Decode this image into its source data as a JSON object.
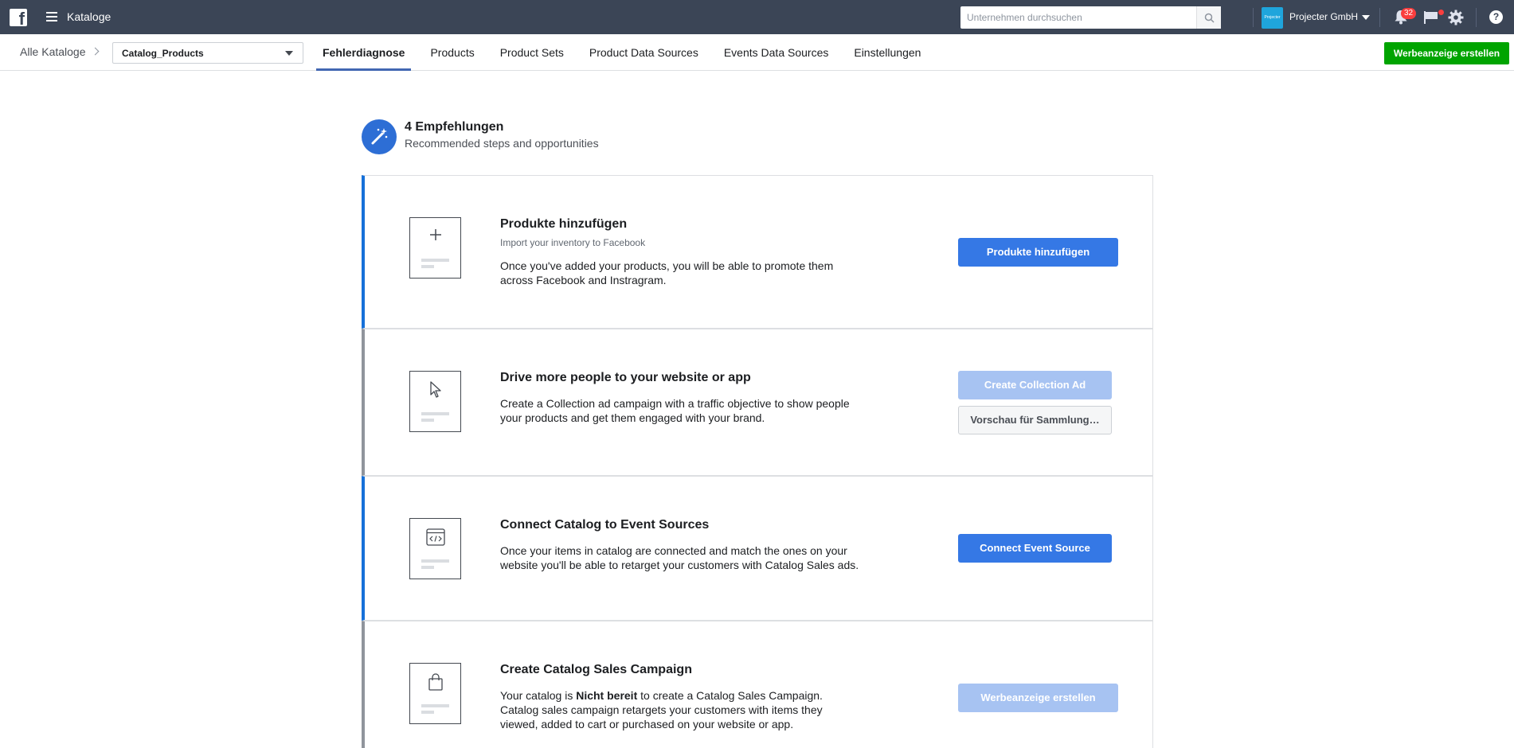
{
  "topbar": {
    "app_title": "Kataloge",
    "search_placeholder": "Unternehmen durchsuchen",
    "business_name": "Projecter GmbH",
    "business_avatar_text": "Projecter",
    "notification_count": "32",
    "help_label": "?"
  },
  "subnav": {
    "breadcrumb": "Alle Kataloge",
    "catalog_selected": "Catalog_Products",
    "tabs": [
      {
        "label": "Fehlerdiagnose",
        "active": true
      },
      {
        "label": "Products"
      },
      {
        "label": "Product Sets"
      },
      {
        "label": "Product Data Sources"
      },
      {
        "label": "Events Data Sources"
      },
      {
        "label": "Einstellungen"
      }
    ],
    "create_ad_label": "Werbeanzeige erstellen"
  },
  "recommendations": {
    "title": "4 Empfehlungen",
    "subtitle": "Recommended steps and opportunities",
    "cards": [
      {
        "title": "Produkte hinzufügen",
        "subtitle": "Import your inventory to Facebook",
        "body": "Once you've added your products, you will be able to promote them across Facebook and Instragram.",
        "button": "Produkte hinzufügen",
        "icon": "plus-icon"
      },
      {
        "title": "Drive more people to your website or app",
        "body": "Create a Collection ad campaign with a traffic objective to show people your products and get them engaged with your brand.",
        "button": "Create Collection Ad",
        "button2": "Vorschau für Sammlung…",
        "icon": "cursor-icon"
      },
      {
        "title": "Connect Catalog to Event Sources",
        "body": "Once your items in catalog are connected and match the ones on your website you'll be able to retarget your customers with Catalog Sales ads.",
        "button": "Connect Event Source",
        "icon": "code-window-icon"
      },
      {
        "title": "Create Catalog Sales Campaign",
        "body_pre": "Your catalog is ",
        "body_bold": "Nicht bereit",
        "body_post": " to create a Catalog Sales Campaign. Catalog sales campaign retargets your customers with items they viewed, added to cart or purchased on your website or app.",
        "button": "Werbeanzeige erstellen",
        "icon": "shopping-bag-icon"
      }
    ]
  },
  "colors": {
    "topbar": "#3b4556",
    "primary": "#3578e5",
    "green": "#00a400",
    "accent_border": "#1670d9"
  }
}
